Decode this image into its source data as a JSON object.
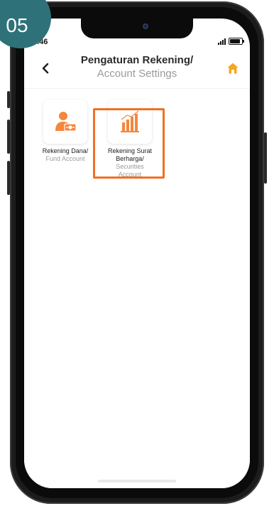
{
  "step_badge": "05",
  "status_bar": {
    "time": "9.46"
  },
  "header": {
    "title_id": "Pengaturan Rekening/",
    "title_en": "Account Settings"
  },
  "tiles": [
    {
      "label_main": "Rekening Dana/",
      "label_sub": "Fund Account",
      "icon": "fund-account-icon"
    },
    {
      "label_main": "Rekening Surat Berharga/",
      "label_sub": "Securities Account",
      "icon": "securities-chart-icon"
    }
  ],
  "colors": {
    "accent": "#f07024",
    "badge": "#2e7179",
    "icon_orange": "#f5873c"
  }
}
